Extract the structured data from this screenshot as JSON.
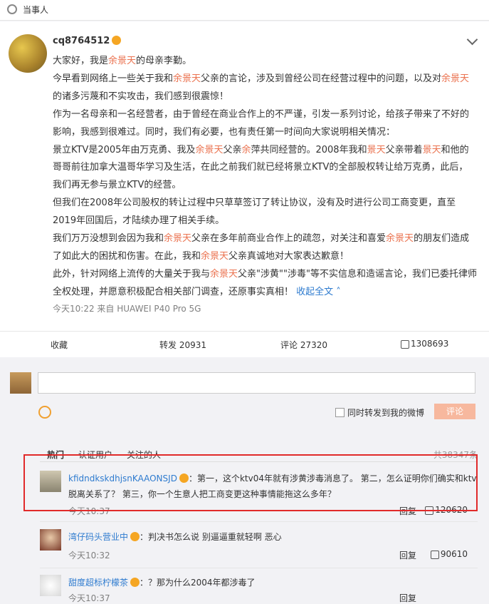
{
  "header": {
    "title": "当事人"
  },
  "post": {
    "username": "cq8764512",
    "paragraphs": [
      [
        "大家好，我是",
        {
          "hl": "余景天"
        },
        "的母亲李勤。"
      ],
      [
        "今早看到网络上一些关于我和",
        {
          "hl": "余景天"
        },
        "父亲的言论，涉及到曾经公司在经营过程中的问题，以及对",
        {
          "hl": "余景天"
        },
        "的诸多污蔑和不实攻击，我们感到很震惊！"
      ],
      [
        "作为一名母亲和一名经营者，由于曾经在商业合作上的不严谨，引发一系列讨论，给孩子带来了不好的影响，我感到很难过。同时，我们有必要，也有责任第一时间向大家说明相关情况："
      ],
      [
        "景立KTV是2005年由万克勇、我及",
        {
          "hl": "余景天"
        },
        "父亲",
        {
          "hl": "余"
        },
        "萍共同经营的。2008年我和",
        {
          "hl": "景天"
        },
        "父亲带着",
        {
          "hl": "景天"
        },
        "和他的哥哥前往加拿大温哥华学习及生活，在此之前我们就已经将景立KTV的全部股权转让给万克勇，此后，我们再无参与景立KTV的经营。"
      ],
      [
        "但我们在2008年公司股权的转让过程中只草草签订了转让协议，没有及时进行公司工商变更，直至2019年回国后，才陆续办理了相关手续。"
      ],
      [
        "我们万万没想到会因为我和",
        {
          "hl": "余景天"
        },
        "父亲在多年前商业合作上的疏忽，对关注和喜爱",
        {
          "hl": "余景天"
        },
        "的朋友们造成了如此大的困扰和伤害。在此，我和",
        {
          "hl": "余景天"
        },
        "父亲真诚地对大家表达歉意！"
      ],
      [
        "此外，针对网络上流传的大量关于我与",
        {
          "hl": "余景天"
        },
        "父亲\"涉黄\"\"涉毒\"等不实信息和造谣言论，我们已委托律师全权处理，并愿意积极配合相关部门调查，还原事实真相！ ",
        {
          "collapse": "收起全文"
        }
      ]
    ],
    "meta": "今天10:22  来自 HUAWEI P40 Pro 5G"
  },
  "actions": {
    "favorite": "收藏",
    "repost": "转发 20931",
    "comment": "评论 27320",
    "likes": "1308693"
  },
  "composer": {
    "sync_label": "同时转发到我的微博",
    "submit_label": "评论"
  },
  "comment_tabs": {
    "hot": "热门",
    "verified": "认证用户",
    "following": "关注的人",
    "total": "共38347条"
  },
  "comments": [
    {
      "name": "kfidndkskdhjsnKAAONSJD",
      "text": "：第一，这个ktv04年就有涉黄涉毒消息了。 第二，怎么证明你们确实和ktv脱离关系了？ 第三，你一个生意人把工商变更这种事情能拖这么多年？",
      "time": "今天10:37",
      "reply": "回复",
      "likes": "120620"
    },
    {
      "name": "湾仔码头营业中",
      "text": "：判决书怎么说 别逼逼重就轻啊 恶心",
      "time": "今天10:32",
      "reply": "回复",
      "likes": "90610"
    },
    {
      "name": "甜度超标柠檬茶",
      "text": "：？那为什么2004年都涉毒了",
      "time": "今天10:37",
      "reply": "回复",
      "likes": ""
    }
  ],
  "colors": {
    "accent": "#eb7350",
    "link": "#2e7bcf",
    "highlight_box": "#e12a2a"
  }
}
